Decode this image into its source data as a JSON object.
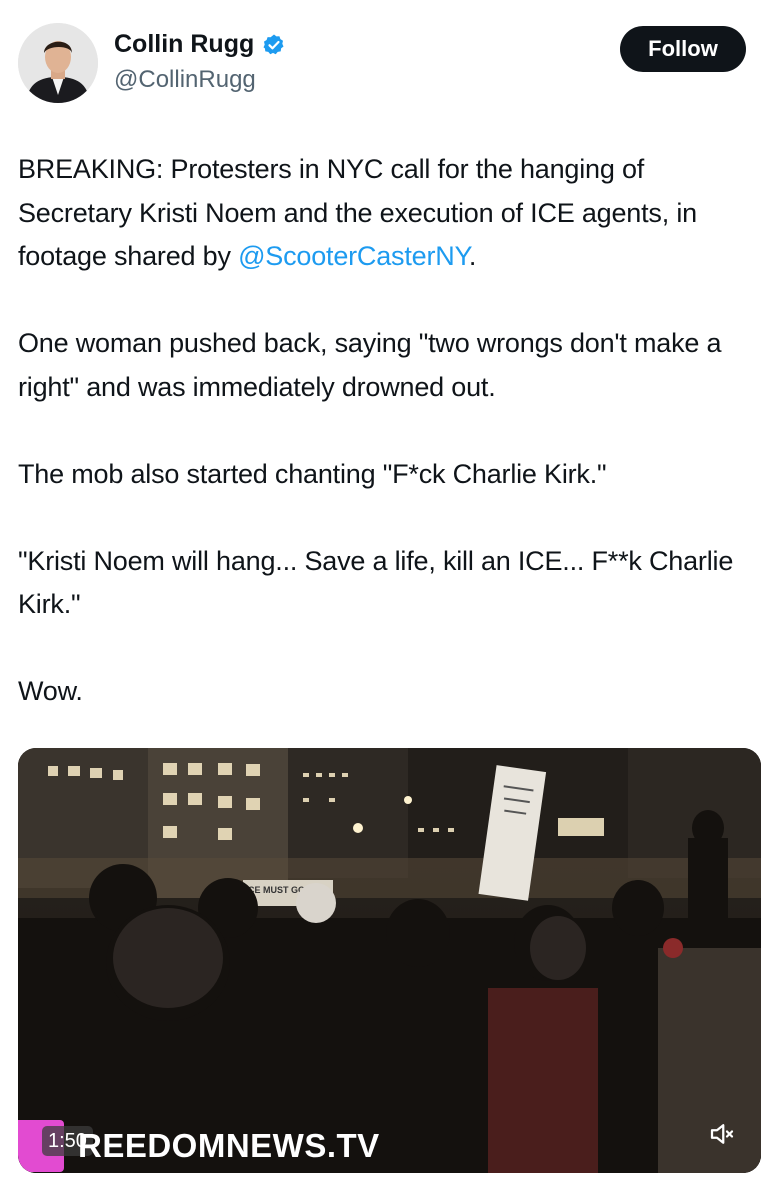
{
  "author": {
    "display_name": "Collin Rugg",
    "handle": "@CollinRugg",
    "verified": true
  },
  "follow_label": "Follow",
  "tweet": {
    "paragraphs": [
      {
        "before": "BREAKING: Protesters in NYC call for the hanging of Secretary Kristi Noem and the execution of ICE agents, in footage shared by ",
        "mention": "@ScooterCasterNY",
        "after": "."
      },
      {
        "text": "One woman pushed back, saying \"two wrongs don't make a right\" and was immediately drowned out."
      },
      {
        "text": "The mob also started chanting \"F*ck Charlie Kirk.\""
      },
      {
        "text": "\"Kristi Noem will hang... Save a life, kill an ICE... F**k Charlie Kirk.\""
      },
      {
        "text": "Wow."
      }
    ]
  },
  "video": {
    "duration": "1:50",
    "watermark": "REEDOMNEWS.TV",
    "sign_text": "CE MUST GO",
    "muted": true
  },
  "colors": {
    "accent": "#1d9bf0",
    "text": "#0f1419",
    "secondary_text": "#536471",
    "follow_bg": "#0f1419",
    "watermark_tab": "#e24bd1"
  },
  "icons": [
    "verified-badge-icon",
    "mute-icon"
  ]
}
